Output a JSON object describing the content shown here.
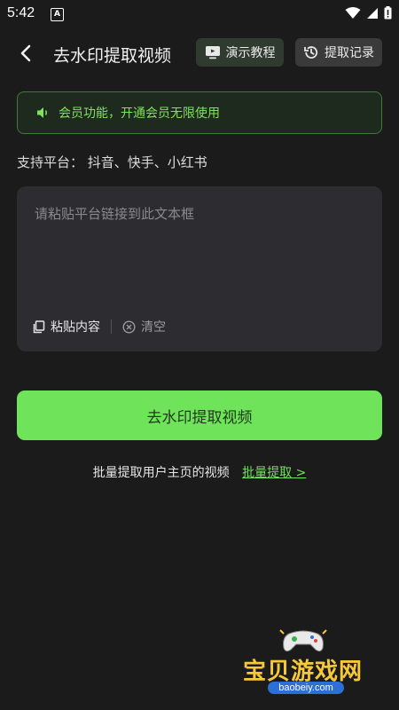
{
  "status": {
    "time": "5:42",
    "app_icon_letter": "A"
  },
  "header": {
    "title": "去水印提取视频",
    "demo_label": "演示教程",
    "record_label": "提取记录"
  },
  "notice": {
    "text": "会员功能，开通会员无限使用"
  },
  "platforms": {
    "text": "支持平台：  抖音、快手、小红书"
  },
  "input": {
    "placeholder": "请粘贴平台链接到此文本框",
    "value": "",
    "paste_label": "粘贴内容",
    "clear_label": "清空"
  },
  "main_button": {
    "label": "去水印提取视频"
  },
  "batch": {
    "text": "批量提取用户主页的视频",
    "link": "批量提取 >"
  },
  "watermark": {
    "text": "宝贝游戏网",
    "url": "baobeiy.com"
  },
  "colors": {
    "accent": "#6fe35a",
    "background": "#1b1b1b",
    "panel": "#2d2d31",
    "notice_border": "#3f7a36"
  }
}
